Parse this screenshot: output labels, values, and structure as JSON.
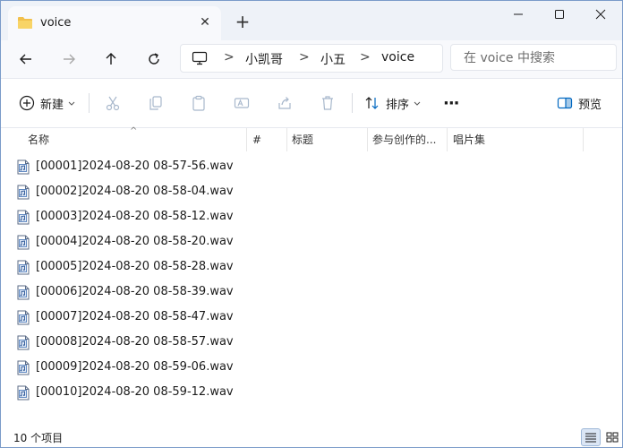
{
  "tab": {
    "title": "voice",
    "close_glyph": "✕",
    "new_tab_glyph": "+"
  },
  "window_controls": {
    "minimize": "minimize-icon",
    "maximize": "maximize-icon",
    "close": "close-icon"
  },
  "nav": {
    "back": "back-arrow-icon",
    "forward": "forward-arrow-icon",
    "up": "up-arrow-icon",
    "refresh": "refresh-icon"
  },
  "address": {
    "separator": ">",
    "crumbs": [
      "小凯哥",
      "小五",
      "voice"
    ]
  },
  "search": {
    "placeholder": "在 voice 中搜索"
  },
  "commands": {
    "new_label": "新建",
    "sort_label": "排序",
    "more": "···",
    "preview_label": "预览"
  },
  "columns": {
    "name": "名称",
    "number": "#",
    "title": "标题",
    "contributing_artists": "参与创作的...",
    "album": "唱片集",
    "sort_indicator": "^"
  },
  "files": [
    {
      "name": "[00001]2024-08-20 08-57-56.wav"
    },
    {
      "name": "[00002]2024-08-20 08-58-04.wav"
    },
    {
      "name": "[00003]2024-08-20 08-58-12.wav"
    },
    {
      "name": "[00004]2024-08-20 08-58-20.wav"
    },
    {
      "name": "[00005]2024-08-20 08-58-28.wav"
    },
    {
      "name": "[00006]2024-08-20 08-58-39.wav"
    },
    {
      "name": "[00007]2024-08-20 08-58-47.wav"
    },
    {
      "name": "[00008]2024-08-20 08-58-57.wav"
    },
    {
      "name": "[00009]2024-08-20 08-59-06.wav"
    },
    {
      "name": "[00010]2024-08-20 08-59-12.wav"
    }
  ],
  "status": {
    "item_count": "10 个项目"
  },
  "colors": {
    "accent": "#0067c0",
    "folder": "#f2c04c",
    "window_border": "#7a9bc9",
    "selected_view": "#dbe6f5"
  }
}
